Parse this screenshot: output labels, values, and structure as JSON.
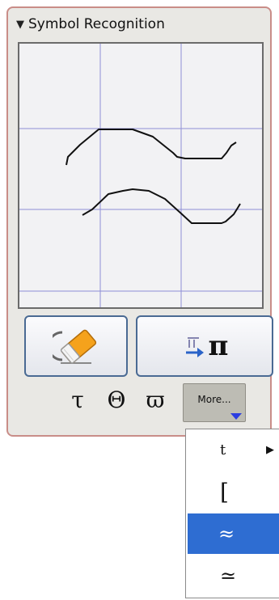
{
  "panel": {
    "title": "Symbol Recognition",
    "collapse_glyph": "▼"
  },
  "buttons": {
    "erase_icon": "eraser-icon",
    "convert_result": "π"
  },
  "suggestions": [
    "τ",
    "Θ",
    "ϖ"
  ],
  "more": {
    "label": "More..."
  },
  "dropdown": {
    "items": [
      {
        "label": "t",
        "submenu": "▶"
      },
      {
        "label": "["
      },
      {
        "label": "≈",
        "selected": true
      },
      {
        "label": "≃"
      }
    ]
  },
  "colors": {
    "panel_border": "#c98d88",
    "grid_line": "#8f8fd6",
    "button_border": "#4a6a93",
    "selected_bg": "#2e6dd2",
    "more_arrow": "#2b3de0"
  }
}
